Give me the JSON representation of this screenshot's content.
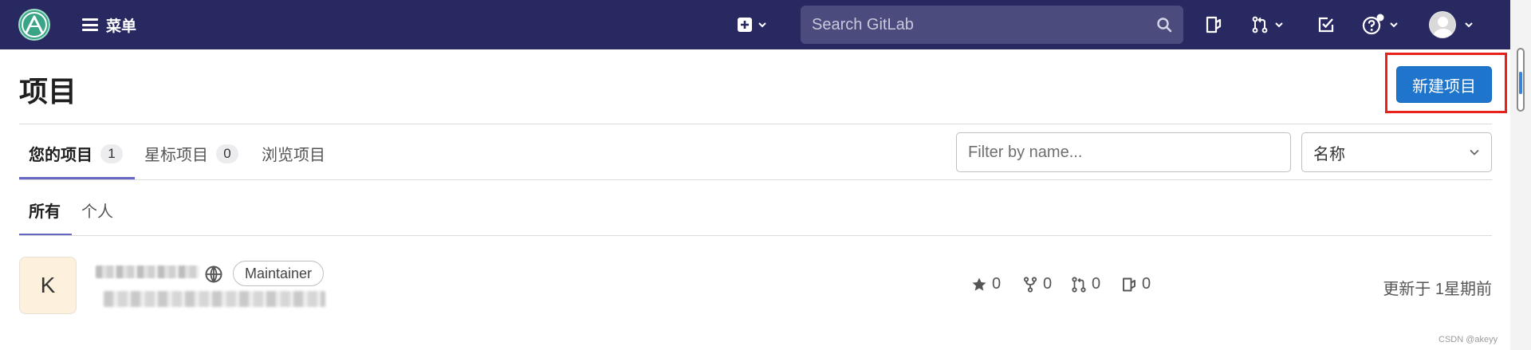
{
  "topbar": {
    "menu_label": "菜单",
    "search_placeholder": "Search GitLab",
    "colors": {
      "bar": "#292961",
      "search_bg": "#4b4b7e"
    }
  },
  "page": {
    "title": "项目",
    "new_project_button": "新建项目",
    "accent": "#1f75cb",
    "highlight_frame": "#e5231b"
  },
  "tabs": [
    {
      "label": "您的项目",
      "count": "1",
      "active": true
    },
    {
      "label": "星标项目",
      "count": "0",
      "active": false
    },
    {
      "label": "浏览项目",
      "active": false
    }
  ],
  "filter": {
    "placeholder": "Filter by name...",
    "sort_selected": "名称"
  },
  "subtabs": [
    {
      "label": "所有",
      "active": true
    },
    {
      "label": "个人",
      "active": false
    }
  ],
  "project": {
    "avatar_letter": "K",
    "role": "Maintainer",
    "stars": "0",
    "forks": "0",
    "merge_requests": "0",
    "issues": "0",
    "updated": "更新于 1星期前"
  },
  "watermark": "CSDN @akeyy"
}
